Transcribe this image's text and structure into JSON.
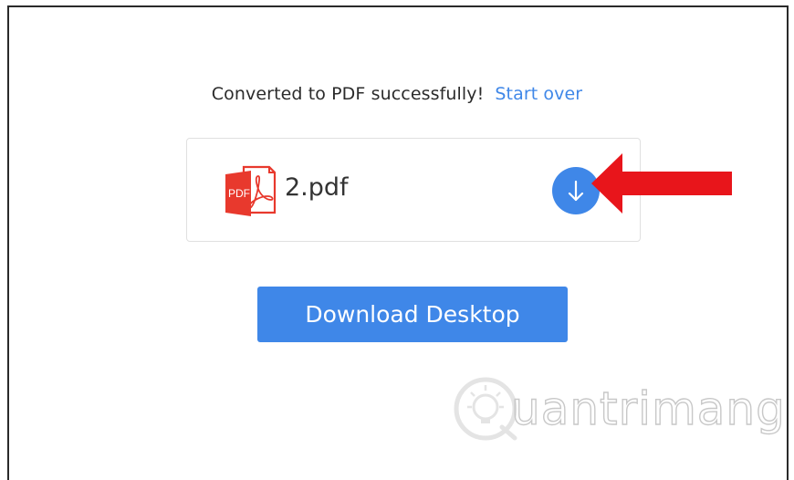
{
  "status": {
    "message": "Converted to PDF successfully!",
    "start_over_label": "Start over"
  },
  "file": {
    "icon": "pdf-file-icon",
    "icon_label": "PDF",
    "name": "2.pdf",
    "download_icon": "arrow-down-icon"
  },
  "download_desktop_label": "Download Desktop",
  "annotation": {
    "icon": "red-pointer-arrow",
    "color": "#e8151b"
  },
  "watermark": {
    "logo": "lightbulb-logo",
    "text": "uantrimang"
  },
  "colors": {
    "accent": "#3f87e8",
    "pdf_red": "#e8392d",
    "arrow_red": "#e8151b"
  }
}
